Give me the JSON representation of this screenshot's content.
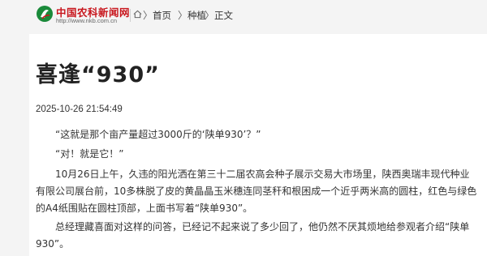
{
  "header": {
    "logo_title": "中国农科新闻网",
    "logo_url": "http://www.nkb.com.cn",
    "breadcrumb": [
      {
        "label": "首页",
        "sep": "〉"
      },
      {
        "label": "种植",
        "sep": "〉"
      },
      {
        "label": "正文",
        "sep": "〉"
      }
    ]
  },
  "article": {
    "title": "喜逢“930”",
    "date": "2025-10-26 21:54:49",
    "paragraphs": [
      "“这就是那个亩产量超过3000斤的‘陕单930’？”",
      "“对！就是它！”",
      "10月26日上午，久违的阳光洒在第三十二届农高会种子展示交易大市场里，陕西奥瑞丰现代种业有限公司展台前，10多株脱了皮的黄晶晶玉米穗连同茎秆和根困成一个近乎两米高的圆柱，红色与绿色的A4纸围贴在圆柱顶部，上面书写着“陕单930”。",
      "总经理藏喜面对这样的问答，已经记不起来说了多少回了，他仍然不厌其烦地给参观者介绍“陕单930”。"
    ]
  },
  "colors": {
    "brand_red": "#c8161d",
    "page_bg": "#f4f4f4",
    "card_bg": "#ffffff"
  }
}
